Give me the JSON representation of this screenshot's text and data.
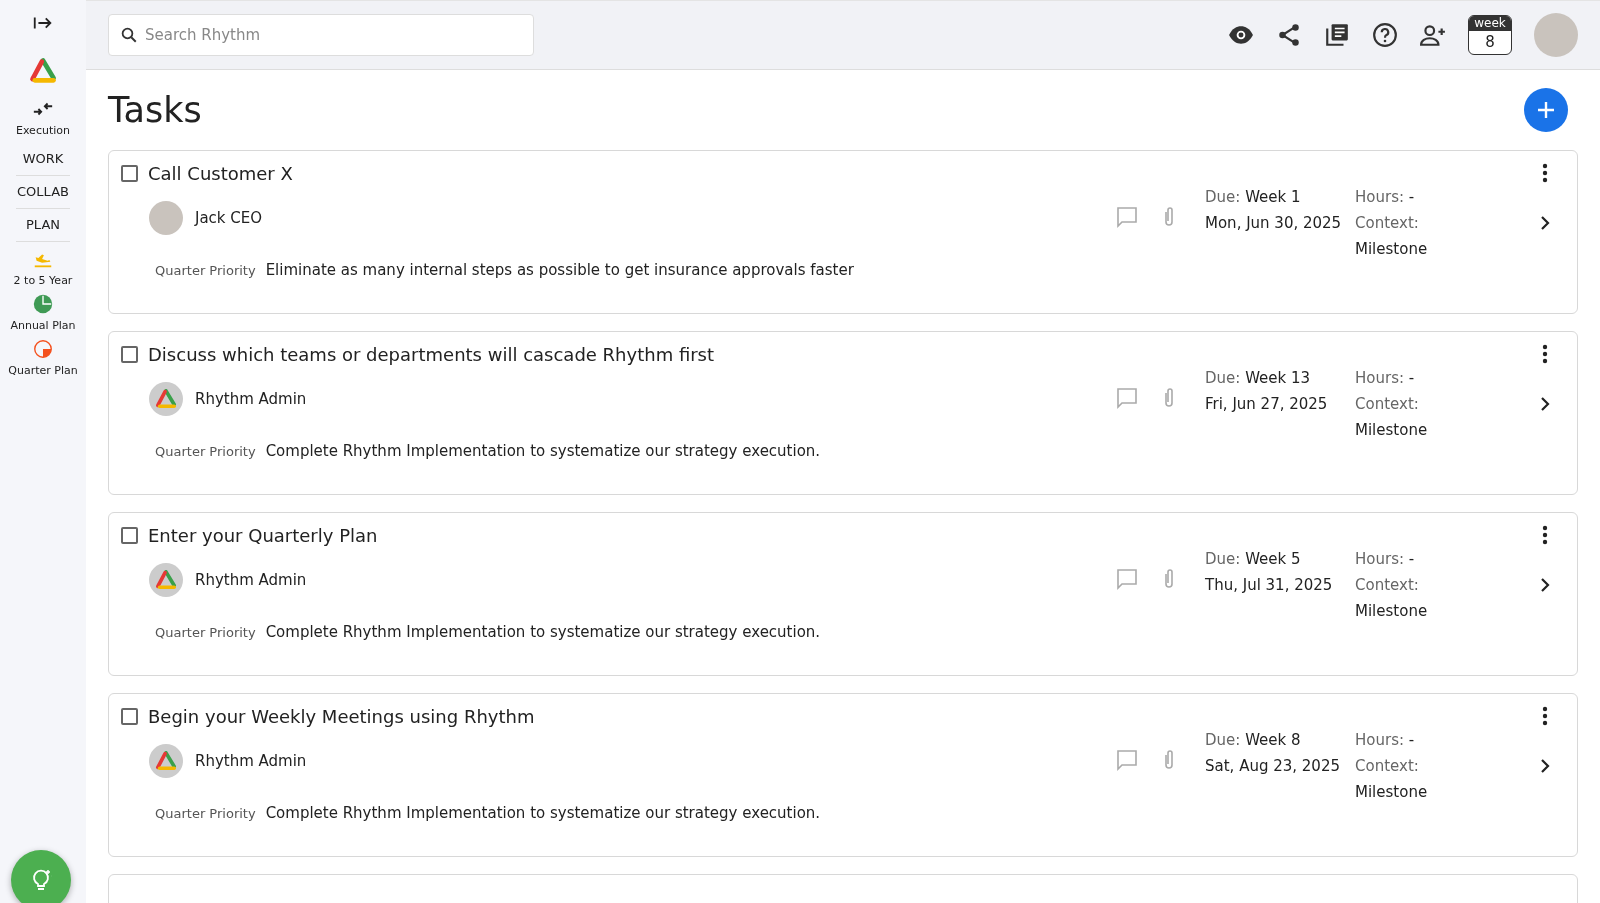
{
  "sidebar": {
    "items": [
      {
        "kind": "expand"
      },
      {
        "kind": "logo"
      },
      {
        "kind": "execution",
        "label": "Execution"
      },
      {
        "kind": "section",
        "label": "WORK"
      },
      {
        "kind": "section",
        "label": "COLLAB"
      },
      {
        "kind": "section",
        "label": "PLAN"
      },
      {
        "kind": "plan-year",
        "label": "2 to 5 Year"
      },
      {
        "kind": "plan-annual",
        "label": "Annual Plan"
      },
      {
        "kind": "plan-quarter",
        "label": "Quarter Plan"
      }
    ]
  },
  "search": {
    "placeholder": "Search Rhythm"
  },
  "week_badge": {
    "label": "week",
    "number": "8"
  },
  "page_title": "Tasks",
  "tasks": [
    {
      "title": "Call Customer X",
      "checked": false,
      "assignee": {
        "name": "Jack CEO",
        "kind": "photo"
      },
      "priority_label": "Quarter Priority",
      "priority": "Eliminate as many internal steps as possible to get insurance approvals faster",
      "due_label": "Due:",
      "due_week": "Week 1",
      "due_date": "Mon, Jun 30, 2025",
      "hours_label": "Hours:",
      "hours": "-",
      "context_label": "Context:",
      "context": "Milestone"
    },
    {
      "title": "Discuss which teams or departments will cascade Rhythm first",
      "checked": false,
      "assignee": {
        "name": "Rhythm Admin",
        "kind": "logo"
      },
      "priority_label": "Quarter Priority",
      "priority": "Complete Rhythm Implementation to systematize our strategy execution.",
      "due_label": "Due:",
      "due_week": "Week 13",
      "due_date": "Fri, Jun 27, 2025",
      "hours_label": "Hours:",
      "hours": "-",
      "context_label": "Context:",
      "context": "Milestone"
    },
    {
      "title": "Enter your Quarterly Plan",
      "checked": false,
      "assignee": {
        "name": "Rhythm Admin",
        "kind": "logo"
      },
      "priority_label": "Quarter Priority",
      "priority": "Complete Rhythm Implementation to systematize our strategy execution.",
      "due_label": "Due:",
      "due_week": "Week 5",
      "due_date": "Thu, Jul 31, 2025",
      "hours_label": "Hours:",
      "hours": "-",
      "context_label": "Context:",
      "context": "Milestone"
    },
    {
      "title": "Begin your Weekly Meetings using Rhythm",
      "checked": false,
      "assignee": {
        "name": "Rhythm Admin",
        "kind": "logo"
      },
      "priority_label": "Quarter Priority",
      "priority": "Complete Rhythm Implementation to systematize our strategy execution.",
      "due_label": "Due:",
      "due_week": "Week 8",
      "due_date": "Sat, Aug 23, 2025",
      "hours_label": "Hours:",
      "hours": "-",
      "context_label": "Context:",
      "context": "Milestone"
    }
  ]
}
